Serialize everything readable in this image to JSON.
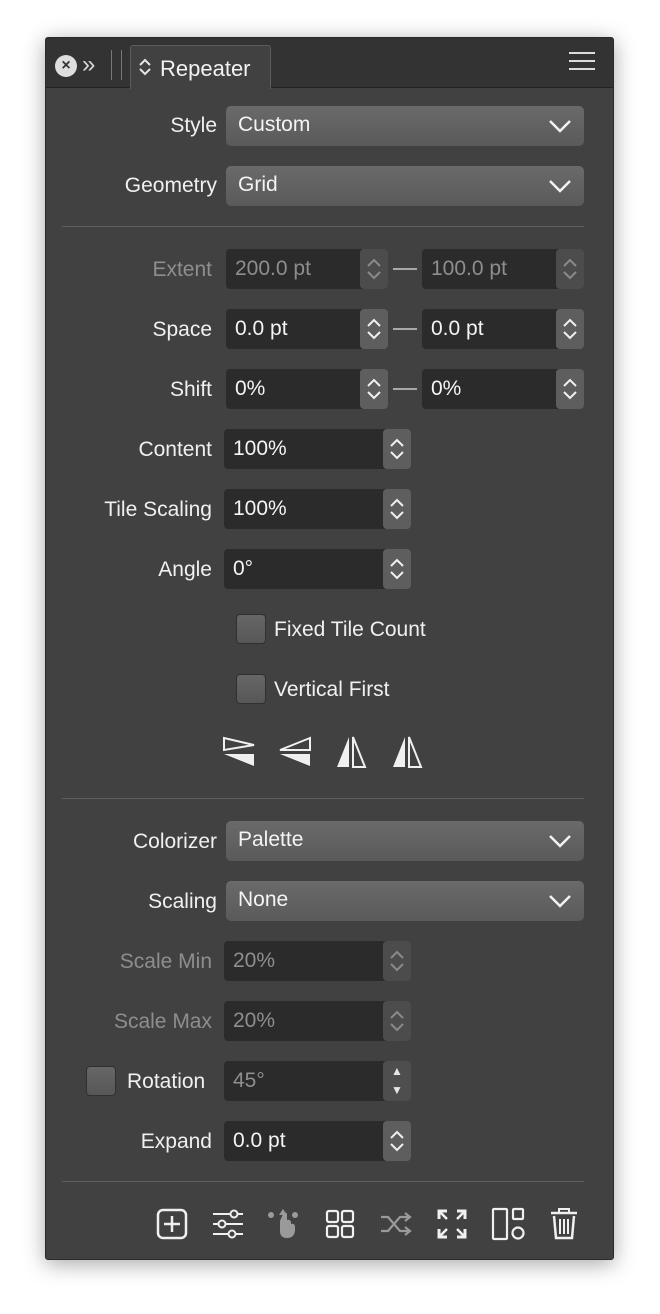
{
  "titlebar": {
    "tab_label": "Repeater"
  },
  "style": {
    "label": "Style",
    "value": "Custom"
  },
  "geometry": {
    "label": "Geometry",
    "value": "Grid"
  },
  "extent": {
    "label": "Extent",
    "value1": "200.0 pt",
    "value2": "100.0 pt"
  },
  "space": {
    "label": "Space",
    "value1": "0.0 pt",
    "value2": "0.0 pt"
  },
  "shift": {
    "label": "Shift",
    "value1": "0%",
    "value2": "0%"
  },
  "content": {
    "label": "Content",
    "value": "100%"
  },
  "tile_scaling": {
    "label": "Tile Scaling",
    "value": "100%"
  },
  "angle": {
    "label": "Angle",
    "value": "0°"
  },
  "fixed_tile_count": {
    "label": "Fixed Tile Count",
    "checked": false
  },
  "vertical_first": {
    "label": "Vertical First",
    "checked": false
  },
  "mirror_modes": [
    "mirror-horizontal-top-icon",
    "mirror-horizontal-bottom-icon",
    "mirror-vertical-left-icon",
    "mirror-vertical-right-icon"
  ],
  "colorizer": {
    "label": "Colorizer",
    "value": "Palette"
  },
  "scaling": {
    "label": "Scaling",
    "value": "None"
  },
  "scale_min": {
    "label": "Scale Min",
    "value": "20%"
  },
  "scale_max": {
    "label": "Scale Max",
    "value": "20%"
  },
  "rotation": {
    "label": "Rotation",
    "value": "45°",
    "checked": false
  },
  "expand": {
    "label": "Expand",
    "value": "0.0 pt"
  },
  "toolbar": [
    "add-icon",
    "adjustments-icon",
    "node-select-icon",
    "grid-icon",
    "shuffle-icon",
    "expand-icon",
    "layout-icon",
    "trash-icon"
  ],
  "colors": {
    "panel_bg": "#414141",
    "field_bg": "#2b2b2b",
    "dropdown_bg": "#626262",
    "text": "#f0f0f0",
    "dim_text": "#8e8e8e"
  }
}
